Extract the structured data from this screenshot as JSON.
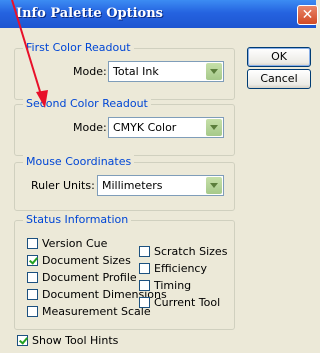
{
  "window": {
    "title": "Info Palette Options",
    "close_glyph": "✕"
  },
  "buttons": {
    "ok": "OK",
    "cancel": "Cancel"
  },
  "first": {
    "legend": "First Color Readout",
    "mode_label": "Mode:",
    "mode_value": "Total Ink"
  },
  "second": {
    "legend": "Second Color Readout",
    "mode_label": "Mode:",
    "mode_value": "CMYK Color"
  },
  "mouse": {
    "legend": "Mouse Coordinates",
    "units_label": "Ruler Units:",
    "units_value": "Millimeters"
  },
  "status": {
    "legend": "Status Information",
    "left": [
      {
        "label": "Version Cue",
        "checked": false
      },
      {
        "label": "Document Sizes",
        "checked": true
      },
      {
        "label": "Document Profile",
        "checked": false
      },
      {
        "label": "Document Dimensions",
        "checked": false
      },
      {
        "label": "Measurement Scale",
        "checked": false
      }
    ],
    "right": [
      {
        "label": "Scratch Sizes",
        "checked": false
      },
      {
        "label": "Efficiency",
        "checked": false
      },
      {
        "label": "Timing",
        "checked": false
      },
      {
        "label": "Current Tool",
        "checked": false
      }
    ]
  },
  "tool_hints": {
    "label": "Show Tool Hints",
    "checked": true
  },
  "colors": {
    "accent_legend": "#0046d5",
    "annotation_arrow": "#e8102a"
  }
}
